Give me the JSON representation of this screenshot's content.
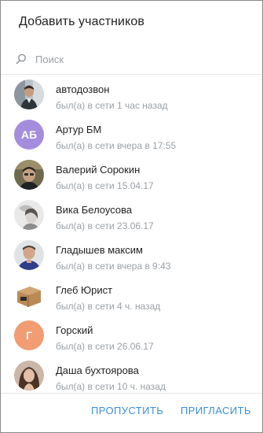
{
  "dialog": {
    "title": "Добавить участников",
    "search": {
      "placeholder": "Поиск",
      "value": ""
    },
    "contacts": [
      {
        "name": "автодозвон",
        "status": "был(а) в сети 1 час назад",
        "avatar": "photo"
      },
      {
        "name": "Артур БМ",
        "status": "был(а) в сети вчера в 17:55",
        "avatar": "initials",
        "initials": "АБ",
        "color": "#a58ddd"
      },
      {
        "name": "Валерий Сорокин",
        "status": "был(а) в сети 15.04.17",
        "avatar": "photo"
      },
      {
        "name": "Вика Белоусова",
        "status": "был(а) в сети 23.06.17",
        "avatar": "photo"
      },
      {
        "name": "Гладышев максим",
        "status": "был(а) в сети вчера в 9:43",
        "avatar": "photo"
      },
      {
        "name": "Глеб Юрист",
        "status": "был(а) в сети 4 ч. назад",
        "avatar": "photo"
      },
      {
        "name": "Горский",
        "status": "был(а) в сети 26.06.17",
        "avatar": "initials",
        "initials": "Г",
        "color": "#f29c72"
      },
      {
        "name": "Даша бухтоярова",
        "status": "был(а) в сети 10 ч. назад",
        "avatar": "photo"
      }
    ],
    "buttons": {
      "skip": "ПРОПУСТИТЬ",
      "invite": "ПРИГЛАСИТЬ"
    },
    "colors": {
      "accent": "#3a8fd8",
      "muted": "#9aa0a6"
    }
  }
}
